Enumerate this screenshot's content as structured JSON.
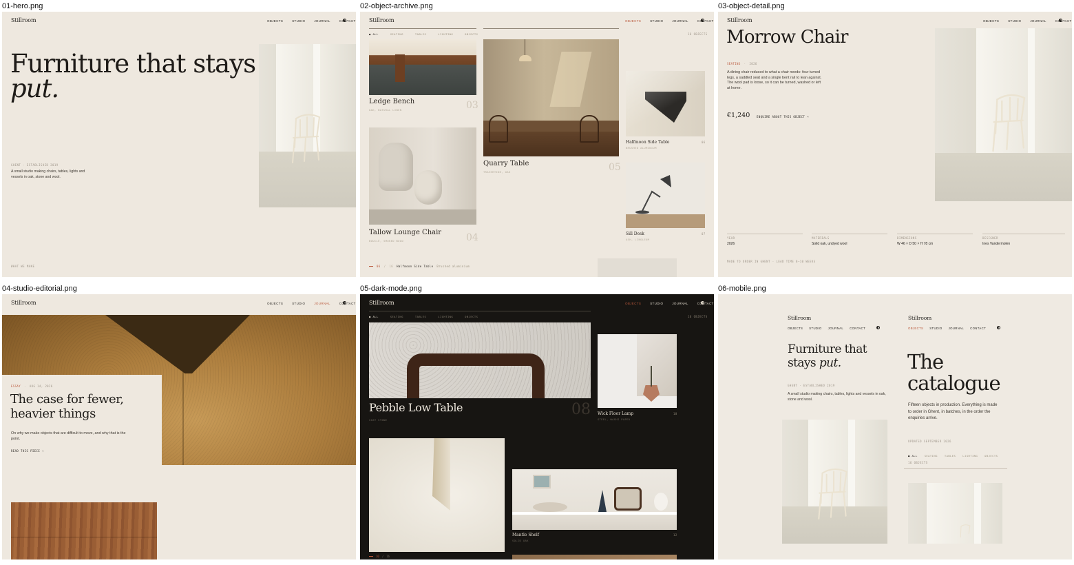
{
  "captions": [
    "01-hero.png",
    "02-object-archive.png",
    "03-object-detail.png",
    "04-studio-editorial.png",
    "05-dark-mode.png",
    "06-mobile.png"
  ],
  "site": {
    "brand": "Stillroom",
    "nav": [
      "OBJECTS",
      "STUDIO",
      "JOURNAL",
      "CONTACT"
    ]
  },
  "hero": {
    "headline": "Furniture that stays",
    "headline_italic": "put.",
    "meta": "GHENT · ESTABLISHED 2019",
    "desc": "A small studio making chairs, tables, lights and vessels in oak, stone and wool.",
    "footer": "WHAT WE MAKE"
  },
  "archive": {
    "filters": [
      "● ALL",
      "SEATING",
      "TABLES",
      "LIGHTING",
      "OBJECTS"
    ],
    "count": "16 OBJECTS",
    "items": [
      {
        "name": "Ledge Bench",
        "sub": "OAK, NATURAL LINEN",
        "index": "03"
      },
      {
        "name": "Tallow Lounge Chair",
        "sub": "BOUCLÉ, SMOKED WOOD",
        "index": "04"
      },
      {
        "name": "Quarry Table",
        "sub": "TRAVERTINE, OAK",
        "index": "05"
      },
      {
        "name": "Halfmoon Side Table",
        "sub": "BRUSHED ALUMINIUM",
        "index": "06"
      },
      {
        "name": "Sill Desk",
        "sub": "ASH, LINOLEUM",
        "index": "07"
      }
    ],
    "footer": {
      "position": "06",
      "total": "16",
      "current_name": "Halfmoon Side Table",
      "current_sub": "Brushed aluminium"
    }
  },
  "detail": {
    "title": "Morrow Chair",
    "meta_cat": "SEATING",
    "meta_year": "2026",
    "desc": "A dining chair reduced to what a chair needs: four turned legs, a saddled seat and a single bent rail to lean against. The wool pad is loose, so it can be turned, washed or left at home.",
    "price": "€1,240",
    "enquire": "ENQUIRE ABOUT THIS OBJECT",
    "specs": [
      {
        "label": "YEAR",
        "value": "2026"
      },
      {
        "label": "MATERIALS",
        "value": "Solid oak, undyed wool"
      },
      {
        "label": "DIMENSIONS",
        "value": "W 46 × D 50 × H 78 cm"
      },
      {
        "label": "DESIGNER",
        "value": "Ines Vandermolen"
      }
    ],
    "footnote": "MADE TO ORDER IN GHENT · LEAD TIME 8–10 WEEKS"
  },
  "editorial": {
    "tag": "ESSAY",
    "date": "AUG 14, 2026",
    "title_line1": "The case for fewer,",
    "title_line2": "heavier things",
    "desc": "On why we make objects that are difficult to move, and why that is the point.",
    "cta": "READ THIS PIECE"
  },
  "dark": {
    "filters": [
      "● ALL",
      "SEATING",
      "TABLES",
      "LIGHTING",
      "OBJECTS"
    ],
    "count": "16 OBJECTS",
    "items": [
      {
        "name": "Pebble Low Table",
        "sub": "CAST STONE",
        "index": "08"
      },
      {
        "name": "Wick Floor Lamp",
        "sub": "STEEL, WASHI PAPER",
        "index": "10"
      },
      {
        "name": "Mantle Shelf",
        "sub": "SOLID OAK",
        "index": "12"
      }
    ],
    "footer": {
      "position": "10",
      "total": "16"
    }
  },
  "mobile": {
    "left": {
      "headline": "Furniture that",
      "headline2": "stays",
      "italic": "put.",
      "meta": "GHENT · ESTABLISHED 2019",
      "desc": "A small studio making chairs, tables, lights and vessels in oak, stone and wool."
    },
    "right": {
      "title1": "The",
      "title2": "catalogue",
      "desc": "Fifteen objects in production. Everything is made to order in Ghent, in batches, in the order the enquiries arrive.",
      "updated": "UPDATED SEPTEMBER 2026",
      "filters": [
        "● ALL",
        "SEATING",
        "TABLES",
        "LIGHTING",
        "OBJECTS"
      ],
      "count": "16 OBJECTS"
    }
  },
  "colors": {
    "accent": "#b9573a",
    "paper": "#eee8df",
    "ink": "#1f1d1a",
    "dark": "#171512"
  }
}
